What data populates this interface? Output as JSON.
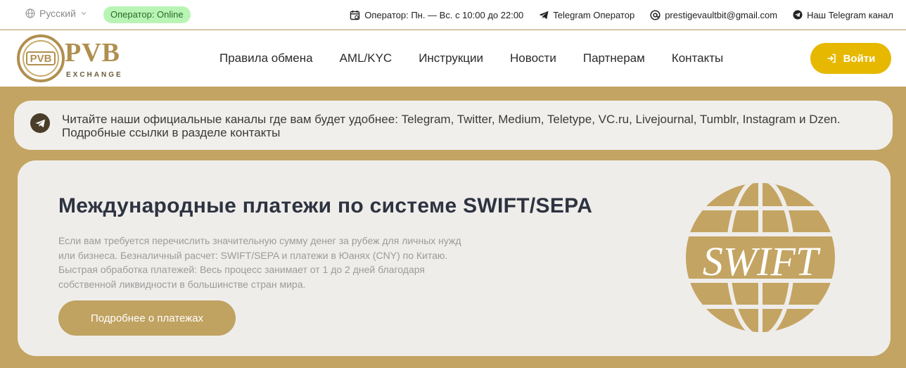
{
  "topbar": {
    "language": "Русский",
    "status_badge": "Оператор: Online",
    "contacts": [
      {
        "icon": "calendar-icon",
        "label": "Оператор: Пн. — Вс. с 10:00 до 22:00"
      },
      {
        "icon": "telegram-icon",
        "label": "Telegram Оператор"
      },
      {
        "icon": "at-icon",
        "label": "prestigevaultbit@gmail.com"
      },
      {
        "icon": "telegram-icon",
        "label": "Наш Telegram канал"
      }
    ]
  },
  "header": {
    "logo_mark": "PVB",
    "logo_text": "PVB",
    "logo_subtext": "EXCHANGE",
    "nav": [
      "Правила обмена",
      "AML/KYC",
      "Инструкции",
      "Новости",
      "Партнерам",
      "Контакты"
    ],
    "login_label": "Войти"
  },
  "notice": {
    "line1": "Читайте наши официальные каналы где вам будет удобнее: Telegram, Twitter, Medium, Teletype, VC.ru, Livejournal, Tumblr, Instagram и Dzen.",
    "line2": "Подробные ссылки в разделе контакты"
  },
  "hero": {
    "title": "Международные платежи по системе SWIFT/SEPA",
    "description": "Если вам требуется перечислить значительную сумму денег за рубеж для личных нужд или бизнеса. Безналичный расчет: SWIFT/SEPA и платежи в Юанях (CNY) по Китаю. Быстрая обработка платежей: Весь процесс занимает от 1 до 2 дней благодаря собственной ликвидности в большинстве стран мира.",
    "button": "Подробнее о платежах",
    "logo_text": "SWIFT"
  },
  "colors": {
    "accent_gold": "#c0a261",
    "button_yellow": "#e6b800",
    "online_green": "#b8f5b4",
    "page_bg": "#c4a462"
  }
}
